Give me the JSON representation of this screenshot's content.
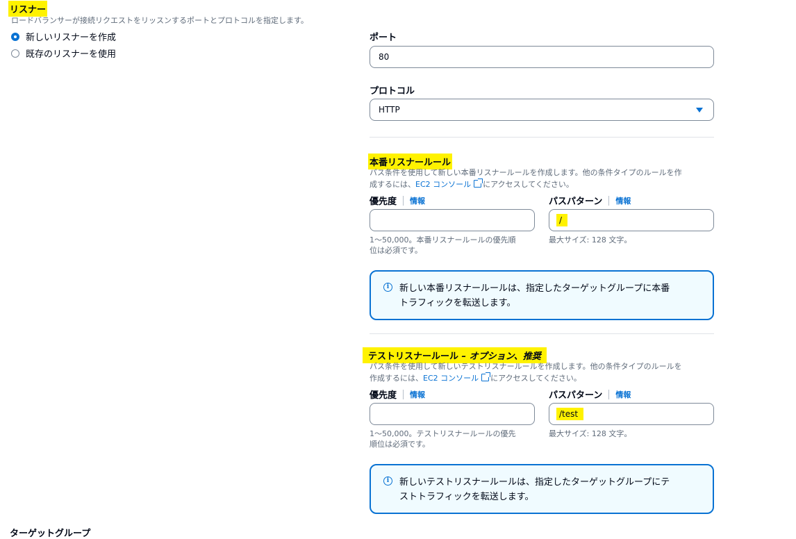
{
  "listener": {
    "title": "リスナー",
    "description": "ロードバランサーが接続リクエストをリッスンするポートとプロトコルを指定します。",
    "options": [
      {
        "label": "新しいリスナーを作成",
        "checked": true
      },
      {
        "label": "既存のリスナーを使用",
        "checked": false
      }
    ],
    "port_label": "ポート",
    "port_value": "80",
    "protocol_label": "プロトコル",
    "protocol_value": "HTTP"
  },
  "production_rule": {
    "title": "本番リスナールール",
    "desc_line1": "パス条件を使用して新しい本番リスナールールを作成します。他の条件タイプのルールを作",
    "desc_prefix": "成するには、",
    "desc_link": "EC2 コンソール",
    "desc_suffix": "にアクセスしてください。",
    "priority_label": "優先度",
    "info_link": "情報",
    "priority_value": "",
    "priority_hint_line1": "1～50,000。本番リスナールールの優先順",
    "priority_hint_line2": "位は必須です。",
    "path_label": "パスパターン",
    "path_value": "/",
    "path_hint": "最大サイズ: 128 文字。",
    "alert_line1": "新しい本番リスナールールは、指定したターゲットグループに本番",
    "alert_line2": "トラフィックを転送します。"
  },
  "test_rule": {
    "title": "テストリスナールール",
    "title_suffix": " – オプション、推奨",
    "desc_line1": "パス条件を使用して新しいテストリスナールールを作成します。他の条件タイプのルールを",
    "desc_prefix": "作成するには、",
    "desc_link": "EC2 コンソール",
    "desc_suffix": "にアクセスしてください。",
    "priority_label": "優先度",
    "info_link": "情報",
    "priority_value": "",
    "priority_hint_line1": "1～50,000。テストリスナールールの優先",
    "priority_hint_line2": "順位は必須です。",
    "path_label": "パスパターン",
    "path_value": "/test",
    "path_hint": "最大サイズ: 128 文字。",
    "alert_line1": "新しいテストリスナールールは、指定したターゲットグループにテ",
    "alert_line2": "ストトラフィックを転送します。"
  },
  "next_section": {
    "title": "ターゲットグループ"
  },
  "colors": {
    "accent": "#0972d3",
    "highlight": "#fff200",
    "alert_bg": "#f0fbff"
  }
}
